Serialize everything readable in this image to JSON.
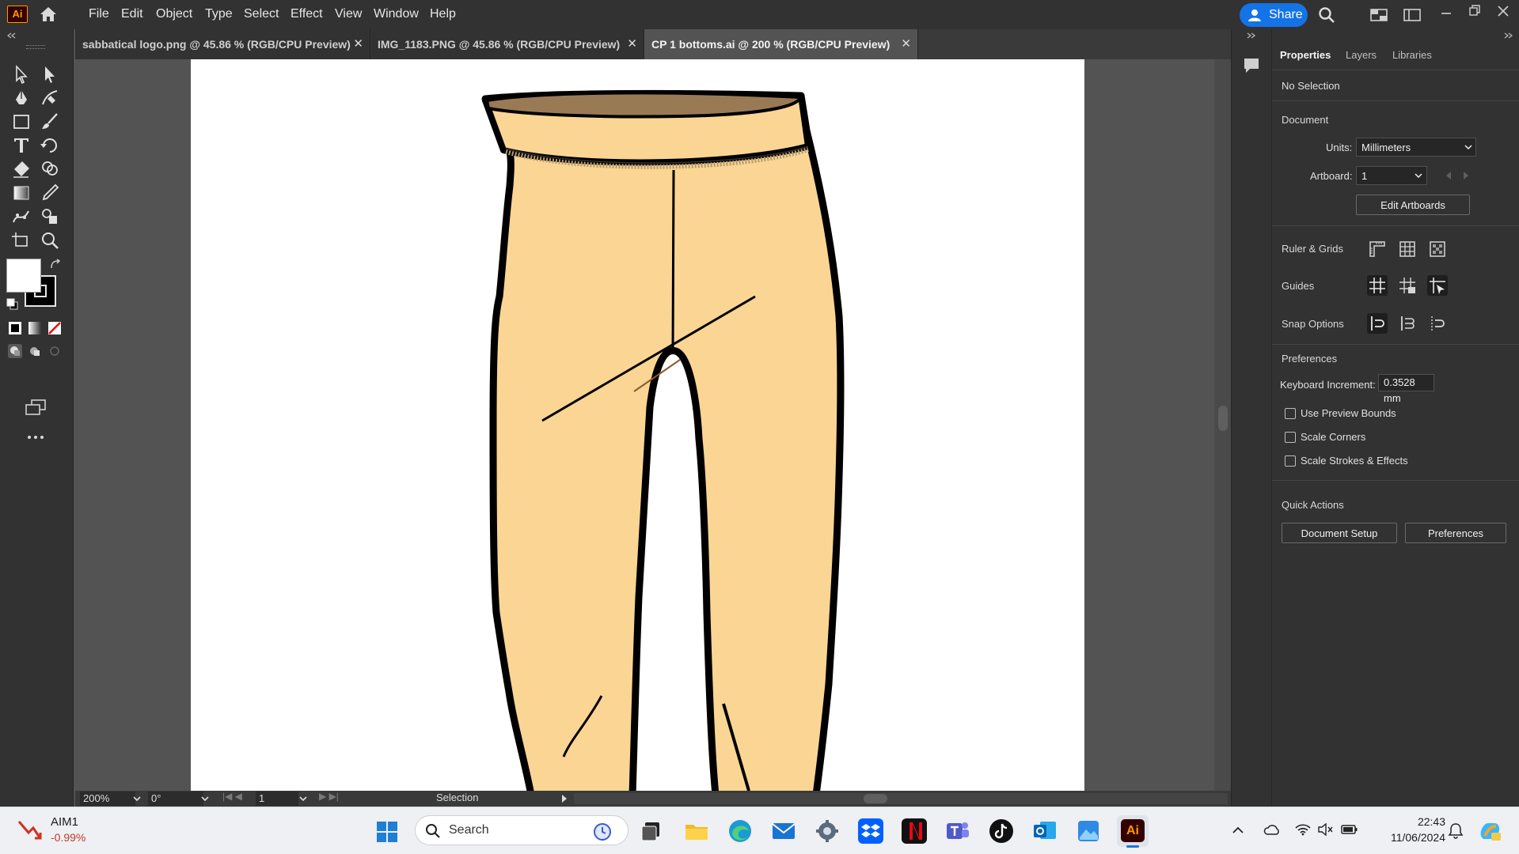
{
  "app": {
    "logo_text": "Ai",
    "accent": "#ff9a00"
  },
  "menu": {
    "items": [
      "File",
      "Edit",
      "Object",
      "Type",
      "Select",
      "Effect",
      "View",
      "Window",
      "Help"
    ],
    "share_label": "Share"
  },
  "tabs": [
    {
      "label": "sabbatical logo.png @ 45.86 % (RGB/CPU Preview)",
      "active": false
    },
    {
      "label": "IMG_1183.PNG @ 45.86 % (RGB/CPU Preview)",
      "active": false
    },
    {
      "label": "CP 1 bottoms.ai @ 200 % (RGB/CPU Preview)",
      "active": true
    }
  ],
  "status": {
    "zoom": "200%",
    "rotation": "0°",
    "artboard": "1",
    "tool": "Selection"
  },
  "panel": {
    "tabs": [
      "Properties",
      "Layers",
      "Libraries"
    ],
    "no_selection": "No Selection",
    "document_heading": "Document",
    "units_label": "Units:",
    "units_value": "Millimeters",
    "artboard_label": "Artboard:",
    "artboard_value": "1",
    "edit_artboards": "Edit Artboards",
    "ruler_grids": "Ruler & Grids",
    "guides": "Guides",
    "snap_options": "Snap Options",
    "preferences_heading": "Preferences",
    "keyboard_increment_label": "Keyboard Increment:",
    "keyboard_increment_value": "0.3528 mm",
    "use_preview_bounds": "Use Preview Bounds",
    "scale_corners": "Scale Corners",
    "scale_strokes": "Scale Strokes & Effects",
    "quick_actions": "Quick Actions",
    "document_setup": "Document Setup",
    "preferences_btn": "Preferences"
  },
  "taskbar": {
    "stock_name": "AIM1",
    "stock_change": "-0.99%",
    "search_placeholder": "Search",
    "time": "22:43",
    "date": "11/06/2024"
  },
  "colors": {
    "pants_fill": "#fad594",
    "waistband_inner": "#9a7a55",
    "outline": "#000000"
  }
}
